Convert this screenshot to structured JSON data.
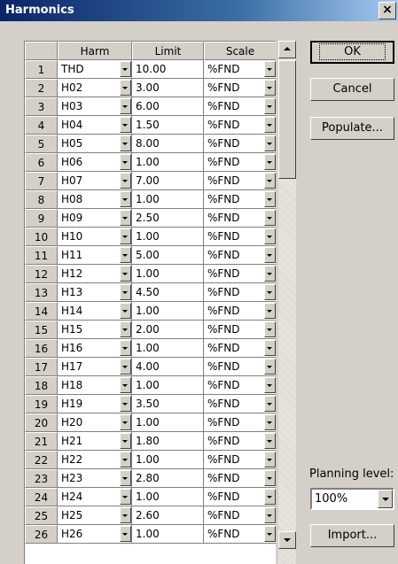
{
  "window": {
    "title": "Harmonics",
    "close_label": "×"
  },
  "grid": {
    "headers": {
      "num": "",
      "harm": "Harm",
      "limit": "Limit",
      "scale": "Scale"
    },
    "rows": [
      {
        "num": "1",
        "harm": "THD",
        "limit": "10.00",
        "scale": "%FND"
      },
      {
        "num": "2",
        "harm": "H02",
        "limit": "3.00",
        "scale": "%FND"
      },
      {
        "num": "3",
        "harm": "H03",
        "limit": "6.00",
        "scale": "%FND"
      },
      {
        "num": "4",
        "harm": "H04",
        "limit": "1.50",
        "scale": "%FND"
      },
      {
        "num": "5",
        "harm": "H05",
        "limit": "8.00",
        "scale": "%FND"
      },
      {
        "num": "6",
        "harm": "H06",
        "limit": "1.00",
        "scale": "%FND"
      },
      {
        "num": "7",
        "harm": "H07",
        "limit": "7.00",
        "scale": "%FND"
      },
      {
        "num": "8",
        "harm": "H08",
        "limit": "1.00",
        "scale": "%FND"
      },
      {
        "num": "9",
        "harm": "H09",
        "limit": "2.50",
        "scale": "%FND"
      },
      {
        "num": "10",
        "harm": "H10",
        "limit": "1.00",
        "scale": "%FND"
      },
      {
        "num": "11",
        "harm": "H11",
        "limit": "5.00",
        "scale": "%FND"
      },
      {
        "num": "12",
        "harm": "H12",
        "limit": "1.00",
        "scale": "%FND"
      },
      {
        "num": "13",
        "harm": "H13",
        "limit": "4.50",
        "scale": "%FND"
      },
      {
        "num": "14",
        "harm": "H14",
        "limit": "1.00",
        "scale": "%FND"
      },
      {
        "num": "15",
        "harm": "H15",
        "limit": "2.00",
        "scale": "%FND"
      },
      {
        "num": "16",
        "harm": "H16",
        "limit": "1.00",
        "scale": "%FND"
      },
      {
        "num": "17",
        "harm": "H17",
        "limit": "4.00",
        "scale": "%FND"
      },
      {
        "num": "18",
        "harm": "H18",
        "limit": "1.00",
        "scale": "%FND"
      },
      {
        "num": "19",
        "harm": "H19",
        "limit": "3.50",
        "scale": "%FND"
      },
      {
        "num": "20",
        "harm": "H20",
        "limit": "1.00",
        "scale": "%FND"
      },
      {
        "num": "21",
        "harm": "H21",
        "limit": "1.80",
        "scale": "%FND"
      },
      {
        "num": "22",
        "harm": "H22",
        "limit": "1.00",
        "scale": "%FND"
      },
      {
        "num": "23",
        "harm": "H23",
        "limit": "2.80",
        "scale": "%FND"
      },
      {
        "num": "24",
        "harm": "H24",
        "limit": "1.00",
        "scale": "%FND"
      },
      {
        "num": "25",
        "harm": "H25",
        "limit": "2.60",
        "scale": "%FND"
      },
      {
        "num": "26",
        "harm": "H26",
        "limit": "1.00",
        "scale": "%FND"
      }
    ]
  },
  "buttons": {
    "ok": "OK",
    "cancel": "Cancel",
    "populate": "Populate...",
    "import": "Import..."
  },
  "planning": {
    "label": "Planning level:",
    "value": "100%"
  },
  "icons": {
    "close": "close-icon",
    "dropdown": "chevron-down-icon",
    "scroll_up": "scroll-up-icon",
    "scroll_down": "scroll-down-icon"
  },
  "colors": {
    "titlebar": "#0a246a",
    "face": "#d4d0c8"
  }
}
